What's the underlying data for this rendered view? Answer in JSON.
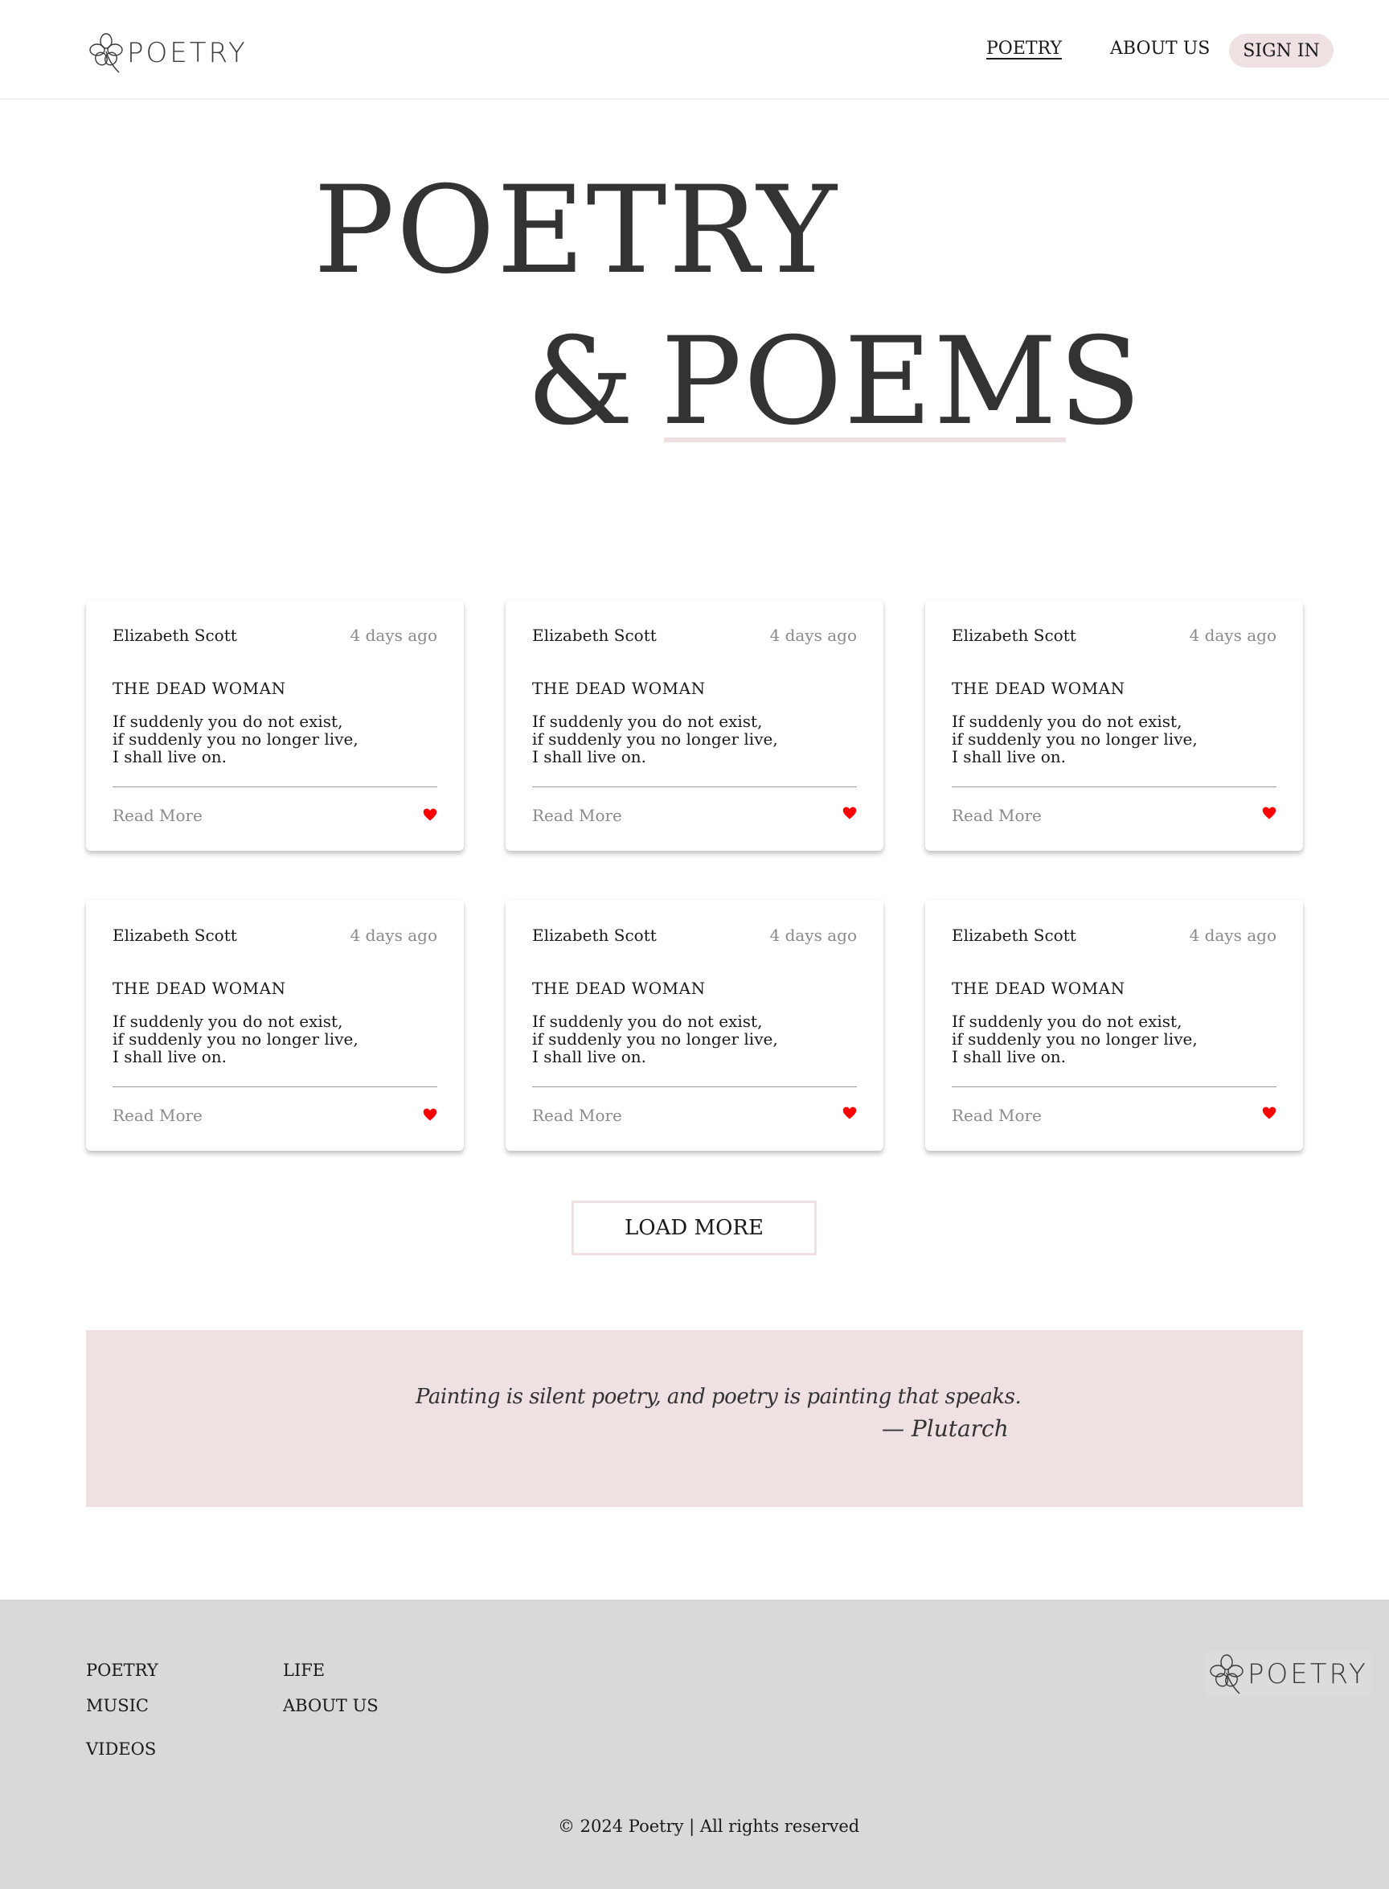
{
  "header": {
    "logo_text": "POETRY",
    "nav": {
      "poetry": "POETRY",
      "about": "ABOUT US",
      "sign_in": "SIGN IN"
    }
  },
  "hero": {
    "line1": "POETRY",
    "amp": "&",
    "line2": "POEMS"
  },
  "cards": [
    {
      "author": "Elizabeth Scott",
      "time": "4 days ago",
      "title": "THE DEAD WOMAN",
      "lines": [
        "If suddenly you do not exist,",
        "if suddenly you no longer live,",
        "I shall live on."
      ],
      "read_more": "Read More"
    },
    {
      "author": "Elizabeth Scott",
      "time": "4 days ago",
      "title": "THE DEAD WOMAN",
      "lines": [
        "If suddenly you do not exist,",
        "if suddenly you no longer live,",
        "I shall live on."
      ],
      "read_more": "Read More"
    },
    {
      "author": "Elizabeth Scott",
      "time": "4 days ago",
      "title": "THE DEAD WOMAN",
      "lines": [
        "If suddenly you do not exist,",
        "if suddenly you no longer live,",
        "I shall live on."
      ],
      "read_more": "Read More"
    },
    {
      "author": "Elizabeth Scott",
      "time": "4 days ago",
      "title": "THE DEAD WOMAN",
      "lines": [
        "If suddenly you do not exist,",
        "if suddenly you no longer live,",
        "I shall live on."
      ],
      "read_more": "Read More"
    },
    {
      "author": "Elizabeth Scott",
      "time": "4 days ago",
      "title": "THE DEAD WOMAN",
      "lines": [
        "If suddenly you do not exist,",
        "if suddenly you no longer live,",
        "I shall live on."
      ],
      "read_more": "Read More"
    },
    {
      "author": "Elizabeth Scott",
      "time": "4 days ago",
      "title": "THE DEAD WOMAN",
      "lines": [
        "If suddenly you do not exist,",
        "if suddenly you no longer live,",
        "I shall live on."
      ],
      "read_more": "Read More"
    }
  ],
  "load_more": "LOAD MORE",
  "quote": {
    "text": "Painting is silent poetry, and poetry is painting that speaks.",
    "author": "— Plutarch"
  },
  "footer": {
    "links": {
      "poetry": "POETRY",
      "music": "MUSIC",
      "videos": "VIDEOS",
      "life": "LIFE",
      "about": "ABOUT US"
    },
    "logo_text": "POETRY",
    "copyright": "©   2024 Poetry | All rights reserved"
  },
  "colors": {
    "accent_pink": "#efe0e1",
    "heart_red": "#ff0000",
    "footer_bg": "#d9d9d9"
  },
  "icons": {
    "logo": "clover-flower-icon",
    "like": "heart-icon"
  }
}
